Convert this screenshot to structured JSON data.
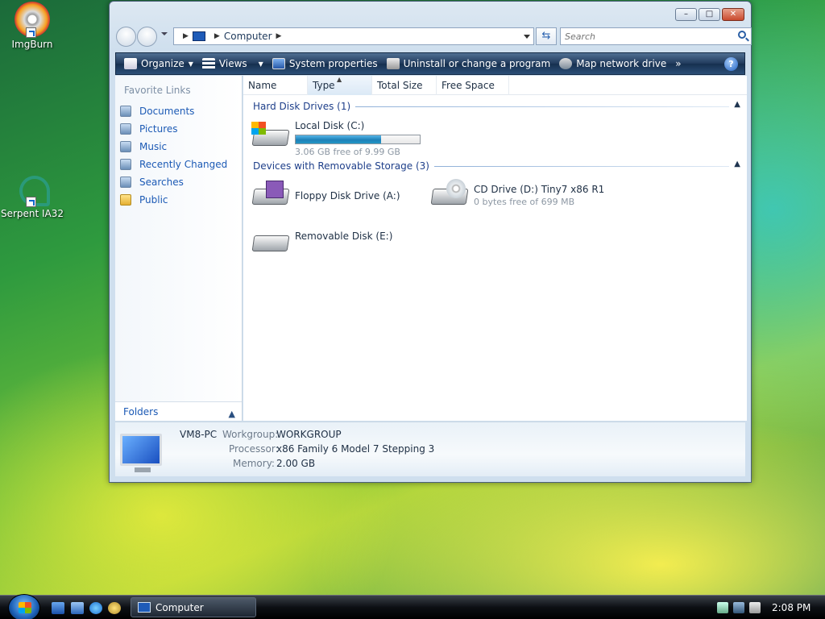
{
  "desktop": {
    "icons": [
      {
        "label": "ImgBurn"
      },
      {
        "label": "Serpent IA32"
      }
    ]
  },
  "window": {
    "address": {
      "breadcrumb": "Computer"
    },
    "search": {
      "placeholder": "Search"
    },
    "toolbar": {
      "organize": "Organize",
      "views": "Views",
      "system_properties": "System properties",
      "uninstall": "Uninstall or change a program",
      "map_drive": "Map network drive",
      "more": "»",
      "help": "?"
    },
    "navigation": {
      "heading": "Favorite Links",
      "items": [
        {
          "label": "Documents"
        },
        {
          "label": "Pictures"
        },
        {
          "label": "Music"
        },
        {
          "label": "Recently Changed"
        },
        {
          "label": "Searches"
        },
        {
          "label": "Public"
        }
      ],
      "folders_label": "Folders"
    },
    "columns": [
      "Name",
      "Type",
      "Total Size",
      "Free Space"
    ],
    "groups": [
      {
        "label": "Hard Disk Drives (1)"
      },
      {
        "label": "Devices with Removable Storage (3)"
      }
    ],
    "drives": {
      "local": {
        "name": "Local Disk (C:)",
        "free": "3.06 GB free of 9.99 GB",
        "used_fraction": 0.69
      },
      "floppy": {
        "name": "Floppy Disk Drive (A:)"
      },
      "cd": {
        "name": "CD Drive (D:) Tiny7 x86 R1",
        "free": "0 bytes free of 699 MB"
      },
      "removable": {
        "name": "Removable Disk (E:)"
      }
    },
    "details": {
      "computer_name": "VM8-PC",
      "workgroup_label": "Workgroup:",
      "workgroup": "WORKGROUP",
      "processor_label": "Processor:",
      "processor": "x86 Family 6 Model 7 Stepping 3",
      "memory_label": "Memory:",
      "memory": "2.00 GB"
    }
  },
  "taskbar": {
    "task": "Computer",
    "clock": "2:08 PM"
  }
}
